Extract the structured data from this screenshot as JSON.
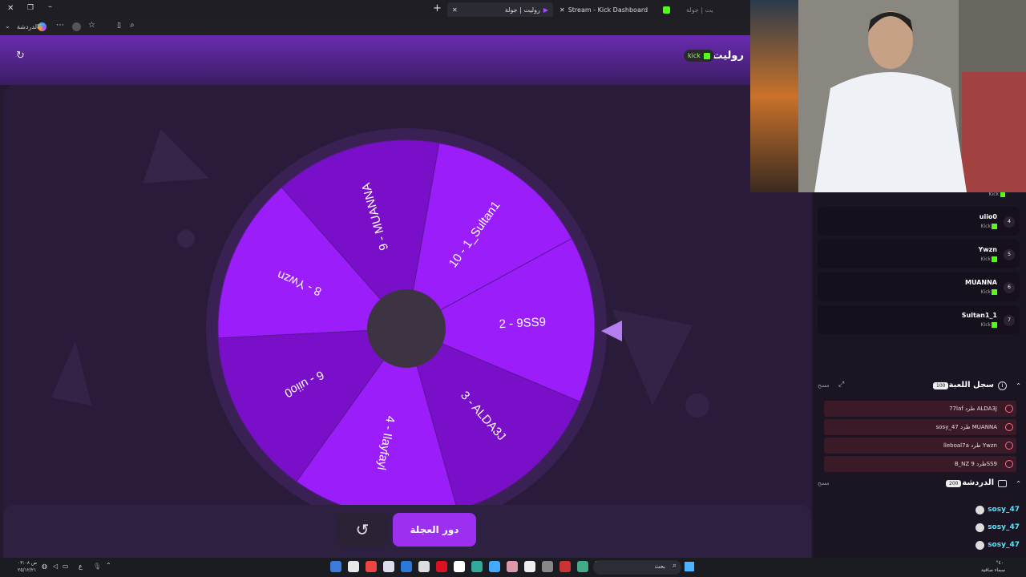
{
  "browser": {
    "tabs": [
      {
        "label": "روليت | جولة"
      },
      {
        "label": "Stream - Kick Dashboard"
      },
      {
        "label": "يت | جولة"
      }
    ],
    "profile_label": "الدردشة"
  },
  "app": {
    "title": "روليت",
    "kick_badge": "kick",
    "wheel": {
      "segments": [
        {
          "label": "10 - 1_Sultan1",
          "color": "#9b1dfa"
        },
        {
          "label": "2 - 9SS9",
          "color": "#9b1dfa"
        },
        {
          "label": "3 - ALDA3J",
          "color": "#7a0fc9"
        },
        {
          "label": "4 - Ilayfayl",
          "color": "#9b1dfa"
        },
        {
          "label": "6 - uiio0",
          "color": "#7a0fc9"
        },
        {
          "label": "8 - Ywzn",
          "color": "#9b1dfa"
        },
        {
          "label": "9 - MUANNA",
          "color": "#7a0fc9"
        }
      ]
    },
    "spin_button": "دور العجلة",
    "colors": {
      "accent": "#9b1dfa",
      "accent_dark": "#7a0fc9",
      "kick_green": "#53fc18"
    }
  },
  "players": [
    {
      "name": "uiio0",
      "platform": "Kick",
      "num": "4"
    },
    {
      "name": "Ywzn",
      "platform": "Kick",
      "num": "5"
    },
    {
      "name": "MUANNA",
      "platform": "Kick",
      "num": "6"
    },
    {
      "name": "Sultan1_1",
      "platform": "Kick",
      "num": "7"
    }
  ],
  "top_partial_platform": "Kick",
  "game_log": {
    "title": "سجل اللعبة",
    "count": "100",
    "clear": "مسح",
    "entries": [
      {
        "text": "77laf طرد ALDA3J"
      },
      {
        "text": "sosy_47 طرد MUANNA"
      },
      {
        "text": "lleboal7a طرد Ywzn"
      },
      {
        "text": "B_NZ طرد 9SS9"
      }
    ]
  },
  "chat": {
    "title": "الدردشة",
    "count": "200",
    "clear": "مسح",
    "messages": [
      {
        "user": "sosy_47"
      },
      {
        "user": "sosy_47"
      },
      {
        "user": "sosy_47"
      }
    ]
  },
  "taskbar": {
    "time": "۰۳:۰۸ ص",
    "date": "٢٥/١٢/٢١",
    "lang": "ع",
    "search": "بحث",
    "weather_temp": "°٤٠",
    "weather_text": "سماء صافية"
  }
}
